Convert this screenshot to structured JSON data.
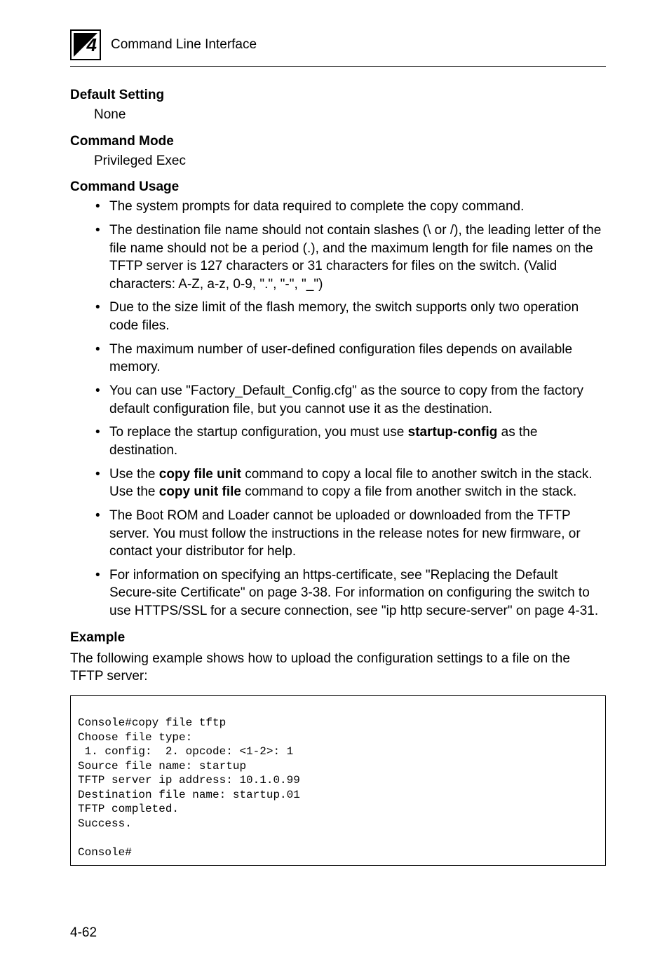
{
  "header": {
    "chapter_num": "4",
    "title": "Command Line Interface"
  },
  "sections": {
    "default_setting": {
      "heading": "Default Setting",
      "body": "None"
    },
    "command_mode": {
      "heading": "Command Mode",
      "body": "Privileged Exec"
    },
    "command_usage": {
      "heading": "Command Usage",
      "bullets": [
        "The system prompts for data required to complete the copy command.",
        "The destination file name should not contain slashes (\\ or /), the leading letter of the file name should not be a period (.), and the maximum length for file names on the TFTP server is 127 characters or 31 characters for files on the switch. (Valid characters: A-Z, a-z, 0-9, \".\", \"-\", \"_\")",
        "Due to the size limit of the flash memory, the switch supports only two operation code files.",
        "The maximum number of user-defined configuration files depends on available memory.",
        "You can use \"Factory_Default_Config.cfg\" as the source to copy from the factory default configuration file, but you cannot use it as the destination.",
        "To replace the startup configuration, you must use <b>startup-config</b> as the destination.",
        "Use the <b>copy file unit</b> command to copy a local file to another switch in the stack. Use the <b>copy unit file</b> command to copy a file from another switch in the stack.",
        "The Boot ROM and Loader cannot be uploaded or downloaded from the TFTP server. You must follow the instructions in the release notes for new firmware, or contact your distributor for help.",
        "For information on specifying an https-certificate, see \"Replacing the Default Secure-site Certificate\" on page 3-38. For information on configuring the switch to use HTTPS/SSL for a secure connection, see \"ip http secure-server\" on page 4-31."
      ]
    },
    "example": {
      "heading": "Example",
      "intro": "The following example shows how to upload the configuration settings to a file on the TFTP server:",
      "code_lines": [
        "Console#copy file tftp",
        "Choose file type:",
        " 1. config:  2. opcode: <1-2>: 1",
        "Source file name: startup",
        "TFTP server ip address: 10.1.0.99",
        "Destination file name: startup.01",
        "TFTP completed.",
        "Success.",
        "",
        "Console#"
      ]
    }
  },
  "page_number": "4-62"
}
